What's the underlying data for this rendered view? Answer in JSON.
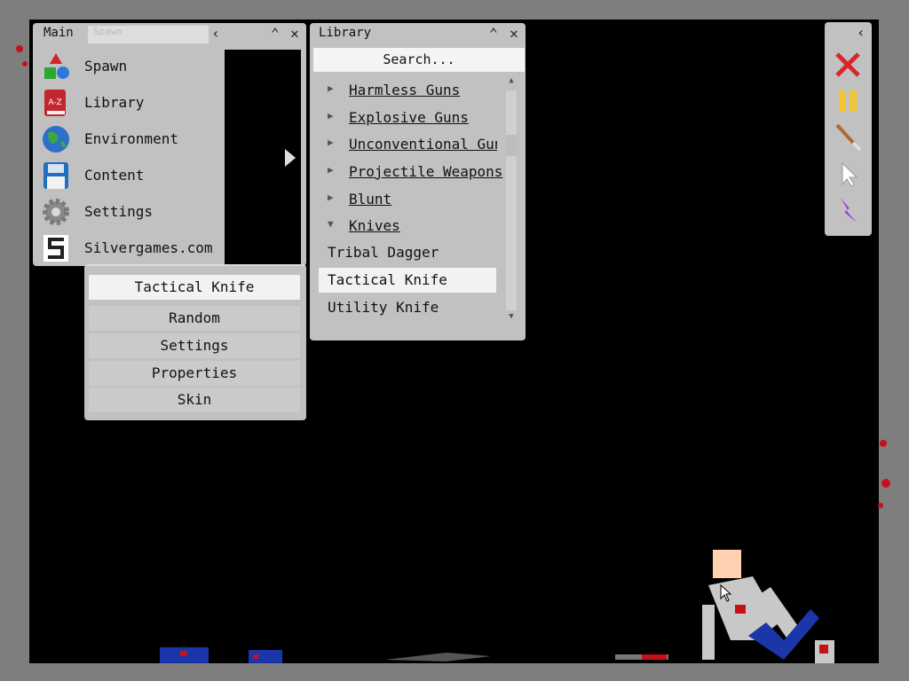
{
  "main_panel": {
    "title": "Main",
    "tab_spawn": "Spawn",
    "items": [
      {
        "label": "Spawn",
        "icon": "shapes-icon"
      },
      {
        "label": "Library",
        "icon": "book-icon"
      },
      {
        "label": "Environment",
        "icon": "globe-icon"
      },
      {
        "label": "Content",
        "icon": "floppy-disk-icon"
      },
      {
        "label": "Settings",
        "icon": "gear-icon"
      },
      {
        "label": "Silvergames.com",
        "icon": "silvergames-logo-icon"
      }
    ]
  },
  "context_menu": {
    "title": "Tactical Knife",
    "items": [
      "Random",
      "Settings",
      "Properties",
      "Skin"
    ]
  },
  "library_panel": {
    "title": "Library",
    "search_label": "Search...",
    "categories": [
      {
        "label": "Harmless Guns",
        "expanded": false
      },
      {
        "label": "Explosive Guns",
        "expanded": false
      },
      {
        "label": "Unconventional Guns",
        "expanded": false
      },
      {
        "label": "Projectile Weapons",
        "expanded": false
      },
      {
        "label": "Blunt",
        "expanded": false
      },
      {
        "label": "Knives",
        "expanded": true
      }
    ],
    "knives": [
      "Tribal Dagger",
      "Tactical Knife",
      "Utility Knife"
    ],
    "selected": "Tactical Knife"
  },
  "toolbar": {
    "tools": [
      "close-icon",
      "pause-icon",
      "knife-tool-icon",
      "cursor-icon",
      "lightning-icon"
    ]
  },
  "colors": {
    "arena": "#000000",
    "border": "#7e7e7e",
    "panel": "#e1e1e1",
    "selection": "#f2f2f2",
    "blood": "#c8101a",
    "figure_blue": "#1a36a8"
  }
}
